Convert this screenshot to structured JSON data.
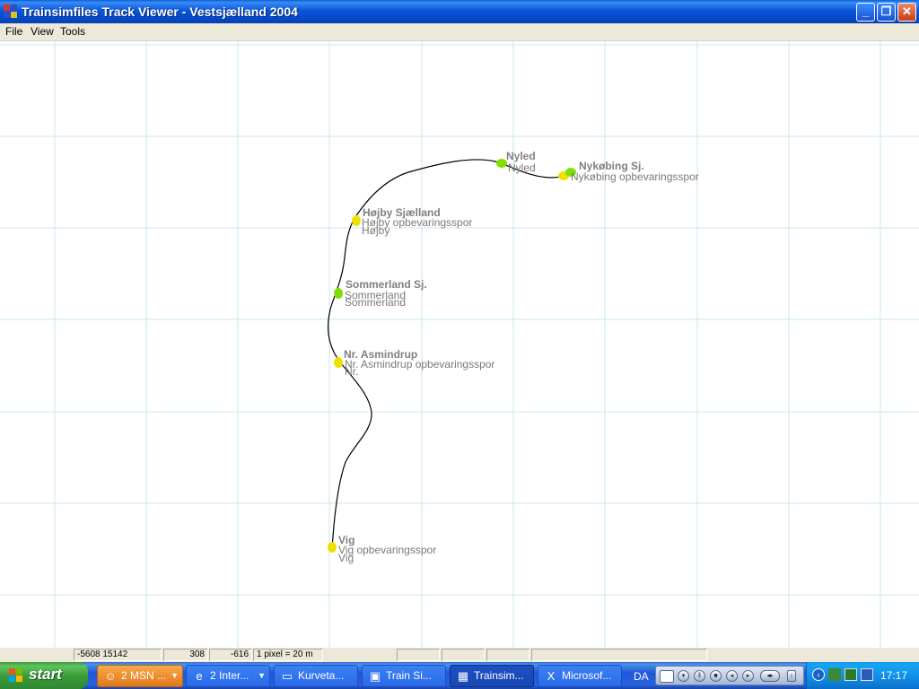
{
  "window": {
    "title": "Trainsimfiles Track Viewer - Vestsjælland 2004"
  },
  "menu": [
    "File",
    "View",
    "Tools"
  ],
  "map": {
    "stations": [
      {
        "name": "Nyled",
        "secondary": [
          "Nyled",
          "Nyled"
        ],
        "marker": "green"
      },
      {
        "name": "Nykøbing Sj.",
        "secondary": [
          "Nykøbing opbevaringsspor",
          "Nykøbing Sj."
        ],
        "marker": "green"
      },
      {
        "name": "Højby Sjælland",
        "secondary": [
          "Højby opbevaringsspor",
          "Højby"
        ],
        "marker": "yellow"
      },
      {
        "name": "Sommerland Sj.",
        "secondary": [
          "Sommerland",
          "Sommerland"
        ],
        "marker": "green"
      },
      {
        "name": "Nr. Asmindrup",
        "secondary": [
          "Nr. Asmindrup opbevaringsspor",
          "Nr."
        ],
        "marker": "yellow"
      },
      {
        "name": "Vig",
        "secondary": [
          "Vig opbevaringsspor",
          "Vig"
        ],
        "marker": "yellow"
      }
    ]
  },
  "status": {
    "coords": "-5608 15142",
    "val1": "308",
    "val2": "-616",
    "scale": "1 pixel = 20 m"
  },
  "taskbar": {
    "start_label": "start",
    "tasks": [
      {
        "label": "2 MSN ...",
        "icon": "msn-icon"
      },
      {
        "label": "2 Inter...",
        "icon": "ie-icon"
      },
      {
        "label": "Kurveta...",
        "icon": "folder-icon"
      },
      {
        "label": "Train Si...",
        "icon": "train-icon"
      },
      {
        "label": "Trainsim...",
        "icon": "app-icon"
      },
      {
        "label": "Microsof...",
        "icon": "excel-icon"
      }
    ],
    "language": "DA",
    "clock": "17:17"
  },
  "colors": {
    "grid": "#c9e7ee",
    "track": "#000000",
    "marker_green": "#7ee000",
    "marker_yellow": "#f0e000"
  }
}
